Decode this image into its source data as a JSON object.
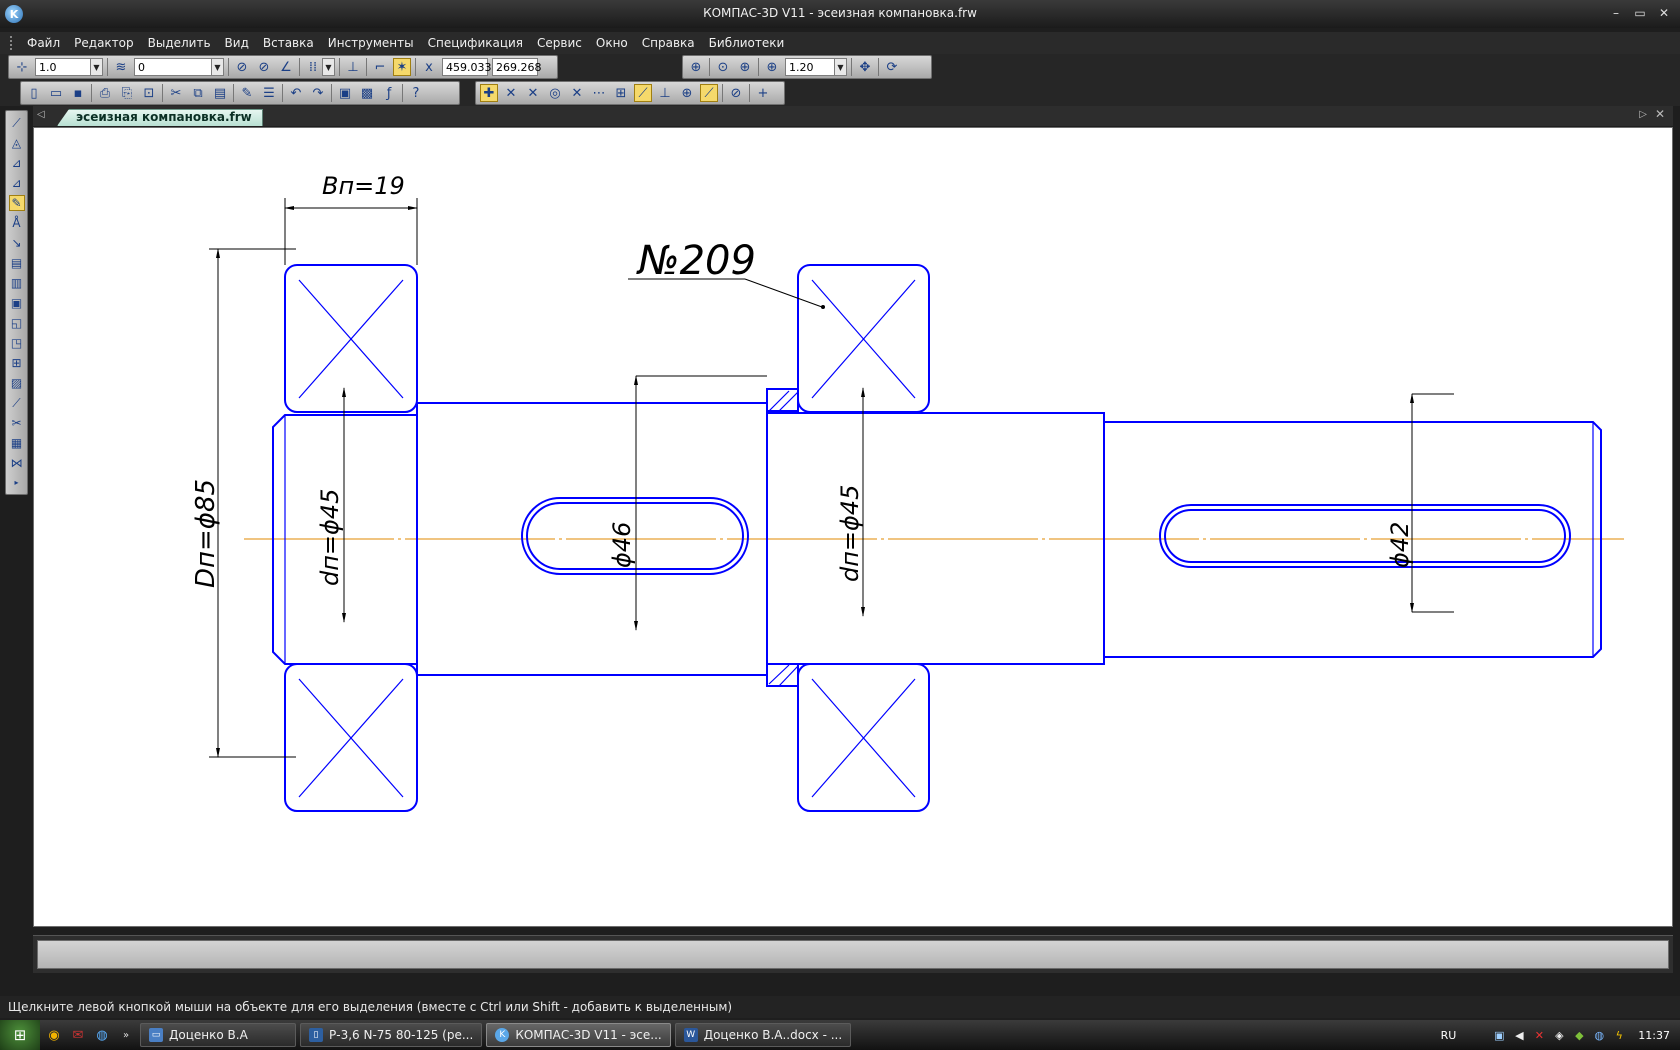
{
  "window": {
    "logo": "K",
    "title": "КОМПАС-3D V11 - эсеизная компановка.frw",
    "minimize": "–",
    "restore": "▭",
    "close": "✕"
  },
  "menu": [
    "Файл",
    "Редактор",
    "Выделить",
    "Вид",
    "Вставка",
    "Инструменты",
    "Спецификация",
    "Сервис",
    "Окно",
    "Справка",
    "Библиотеки"
  ],
  "toolbar1": {
    "step_value": "1.0",
    "layer_value": "0",
    "coord_x": "459.033",
    "coord_y": "269.268",
    "zoom_value": "1.20"
  },
  "tab": {
    "filename": "эсеизная компановка.frw",
    "left_arrow": "◁",
    "right_arrow": "▷",
    "close": "✕"
  },
  "drawing": {
    "bearing_width": "Bп=19",
    "bearing_outer_dia": "Dп=ϕ85",
    "bearing_inner_dia_left": "dп=ϕ45",
    "bearing_inner_dia_right": "dп=ϕ45",
    "shaft_dia_middle": "ϕ46",
    "shaft_dia_end": "ϕ42",
    "bearing_number": "№209",
    "line_color": "#0000ff",
    "axis_color": "#e08a00",
    "dim_color": "#000000"
  },
  "status": {
    "hint": "Щелкните левой кнопкой мыши на объекте для его выделения (вместе с Ctrl или Shift - добавить к выделенным)"
  },
  "taskbar": {
    "start": "⊞",
    "tasks": [
      {
        "label": "Доценко В.А",
        "icon": "folder-icon"
      },
      {
        "label": "Р-3,6 N-75 80-125 (ре...",
        "icon": "document-icon"
      },
      {
        "label": "КОМПАС-3D V11 - эсе...",
        "icon": "kompas-icon"
      },
      {
        "label": "Доценко В.А..docx - ...",
        "icon": "word-icon"
      }
    ],
    "lang": "RU",
    "clock": "11:37"
  }
}
